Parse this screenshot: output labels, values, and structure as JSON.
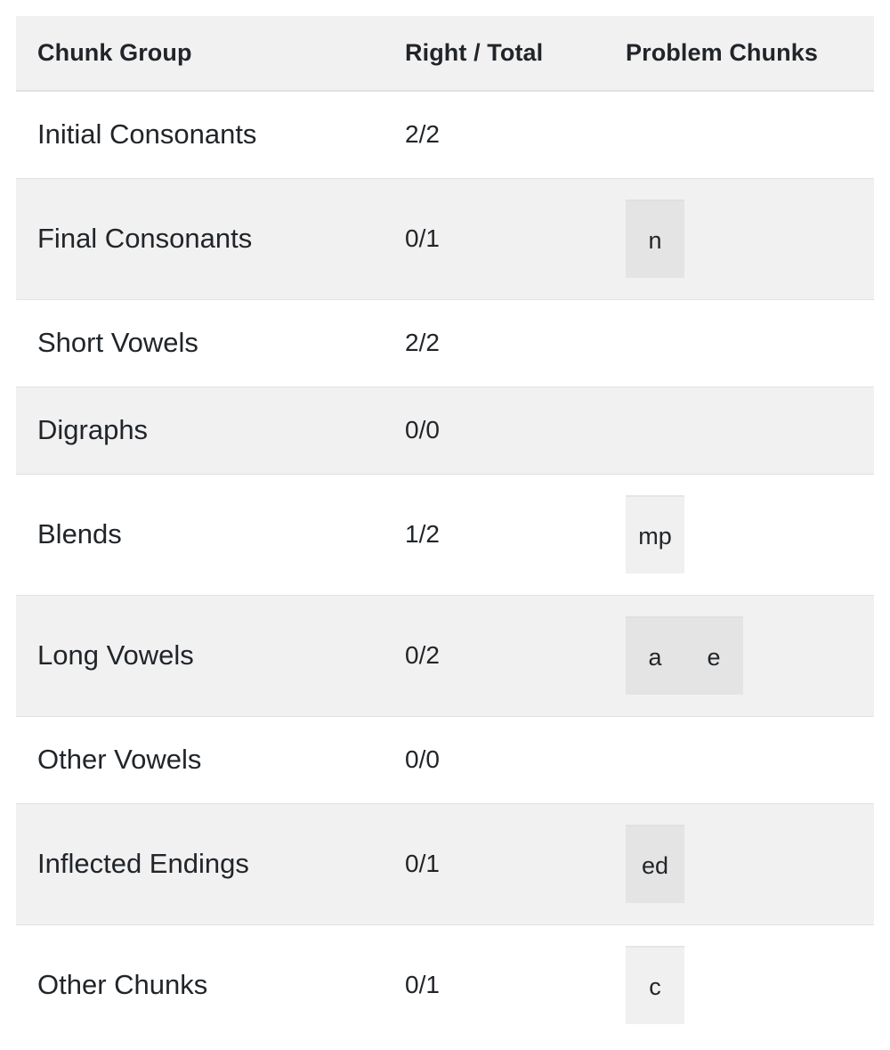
{
  "table": {
    "headers": {
      "group": "Chunk Group",
      "score": "Right / Total",
      "chunks": "Problem Chunks"
    },
    "rows": [
      {
        "group": "Initial Consonants",
        "score": "2/2",
        "chunks": []
      },
      {
        "group": "Final Consonants",
        "score": "0/1",
        "chunks": [
          "n"
        ]
      },
      {
        "group": "Short Vowels",
        "score": "2/2",
        "chunks": []
      },
      {
        "group": "Digraphs",
        "score": "0/0",
        "chunks": []
      },
      {
        "group": "Blends",
        "score": "1/2",
        "chunks": [
          "mp"
        ]
      },
      {
        "group": "Long Vowels",
        "score": "0/2",
        "chunks": [
          "a",
          "e"
        ]
      },
      {
        "group": "Other Vowels",
        "score": "0/0",
        "chunks": []
      },
      {
        "group": "Inflected Endings",
        "score": "0/1",
        "chunks": [
          "ed"
        ]
      },
      {
        "group": "Other Chunks",
        "score": "0/1",
        "chunks": [
          "c"
        ]
      }
    ]
  },
  "colors": {
    "header_background": "#f1f1f1",
    "striped_row_background": "#f1f1f1",
    "row_background": "#ffffff",
    "border": "#dee2e6",
    "text": "#212529",
    "badge_on_white": "#f0f0f0",
    "badge_on_striped": "#e4e4e4"
  }
}
